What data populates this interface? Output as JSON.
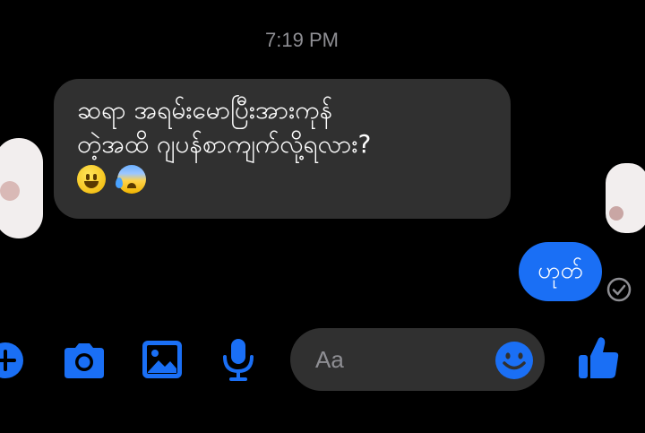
{
  "thread": {
    "timestamp": "7:19 PM",
    "incoming_message": {
      "line1": "ဆရာ အရမ်းမောပြီးအားကုန်",
      "line2": "တဲ့အထိ ဂျပန်စာကျက်လို့ရလား?",
      "emojis": [
        "grinning-face",
        "anxious-face-with-sweat"
      ]
    },
    "outgoing_message": {
      "text": "ဟုတ်",
      "status": "sent-check"
    }
  },
  "composer": {
    "placeholder": "Aa",
    "value": "",
    "tools": [
      "plus-icon",
      "camera-icon",
      "image-icon",
      "microphone-icon"
    ],
    "emoji_button": "smiley-icon",
    "send_button": "thumbs-up-icon"
  },
  "colors": {
    "background": "#000000",
    "incoming_bubble": "#303030",
    "outgoing_bubble": "#1a6ff5",
    "accent": "#1a6ff5",
    "timestamp": "#8e8e93"
  }
}
